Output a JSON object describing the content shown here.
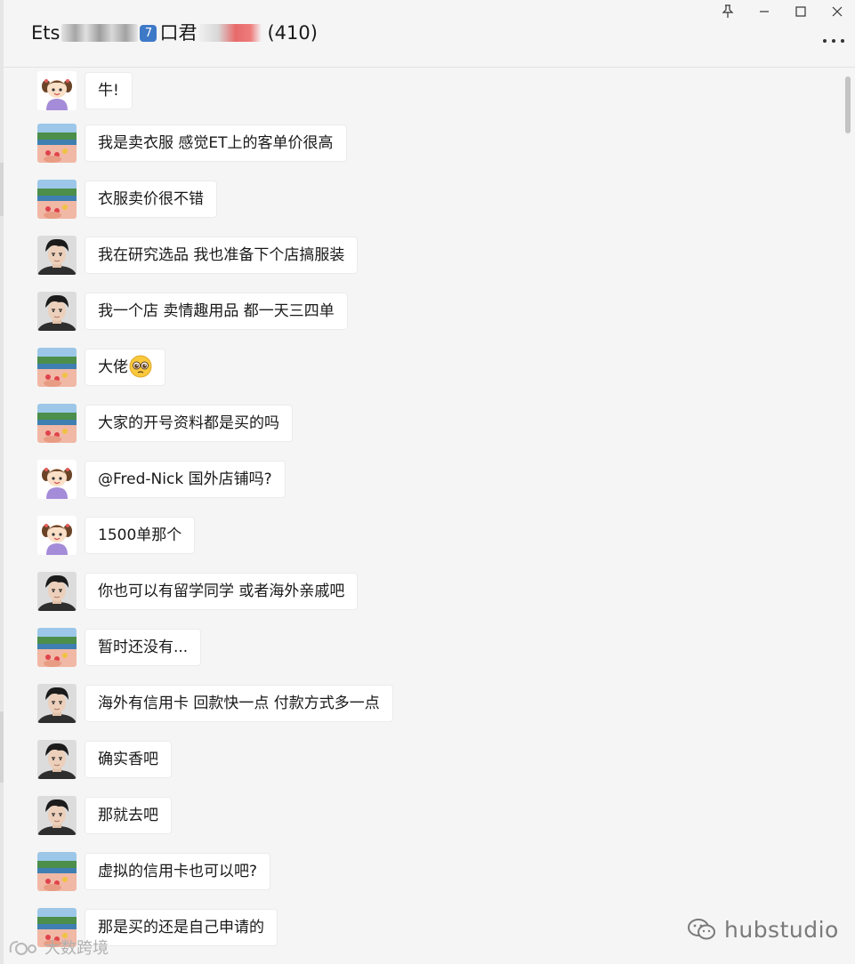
{
  "window": {
    "title_prefix": "Ets",
    "title_badge": "7",
    "title_mid": "口君",
    "member_count": "(410)",
    "more_icon": "more-horizontal-icon",
    "pin_icon": "pin-icon",
    "minimize_icon": "minimize-icon",
    "maximize_icon": "maximize-icon",
    "close_icon": "close-icon"
  },
  "messages": [
    {
      "avatar": "girl-cartoon",
      "text": "牛!"
    },
    {
      "avatar": "beach-photo",
      "text": "我是卖衣服  感觉ET上的客单价很高"
    },
    {
      "avatar": "beach-photo",
      "text": "衣服卖价很不错"
    },
    {
      "avatar": "man-portrait",
      "text": "我在研究选品 我也准备下个店搞服装"
    },
    {
      "avatar": "man-portrait",
      "text": "我一个店 卖情趣用品 都一天三四单"
    },
    {
      "avatar": "beach-photo",
      "text": "大佬",
      "emoji": "pleading-face-emoji"
    },
    {
      "avatar": "beach-photo",
      "text": "大家的开号资料都是买的吗"
    },
    {
      "avatar": "girl-cartoon",
      "text": "@Fred-Nick 国外店铺吗?"
    },
    {
      "avatar": "girl-cartoon",
      "text": "1500单那个"
    },
    {
      "avatar": "man-portrait",
      "text": "你也可以有留学同学 或者海外亲戚吧"
    },
    {
      "avatar": "beach-photo",
      "text": "暂时还没有..."
    },
    {
      "avatar": "man-portrait",
      "text": "海外有信用卡 回款快一点 付款方式多一点"
    },
    {
      "avatar": "man-portrait",
      "text": "确实香吧"
    },
    {
      "avatar": "man-portrait",
      "text": "那就去吧"
    },
    {
      "avatar": "beach-photo",
      "text": "虚拟的信用卡也可以吧?"
    },
    {
      "avatar": "beach-photo",
      "text": "那是买的还是自己申请的"
    }
  ],
  "watermarks": {
    "right_text": "hubstudio",
    "right_icon": "wechat-icon",
    "left_text": "大数跨境",
    "left_icon": "logo-icon"
  }
}
